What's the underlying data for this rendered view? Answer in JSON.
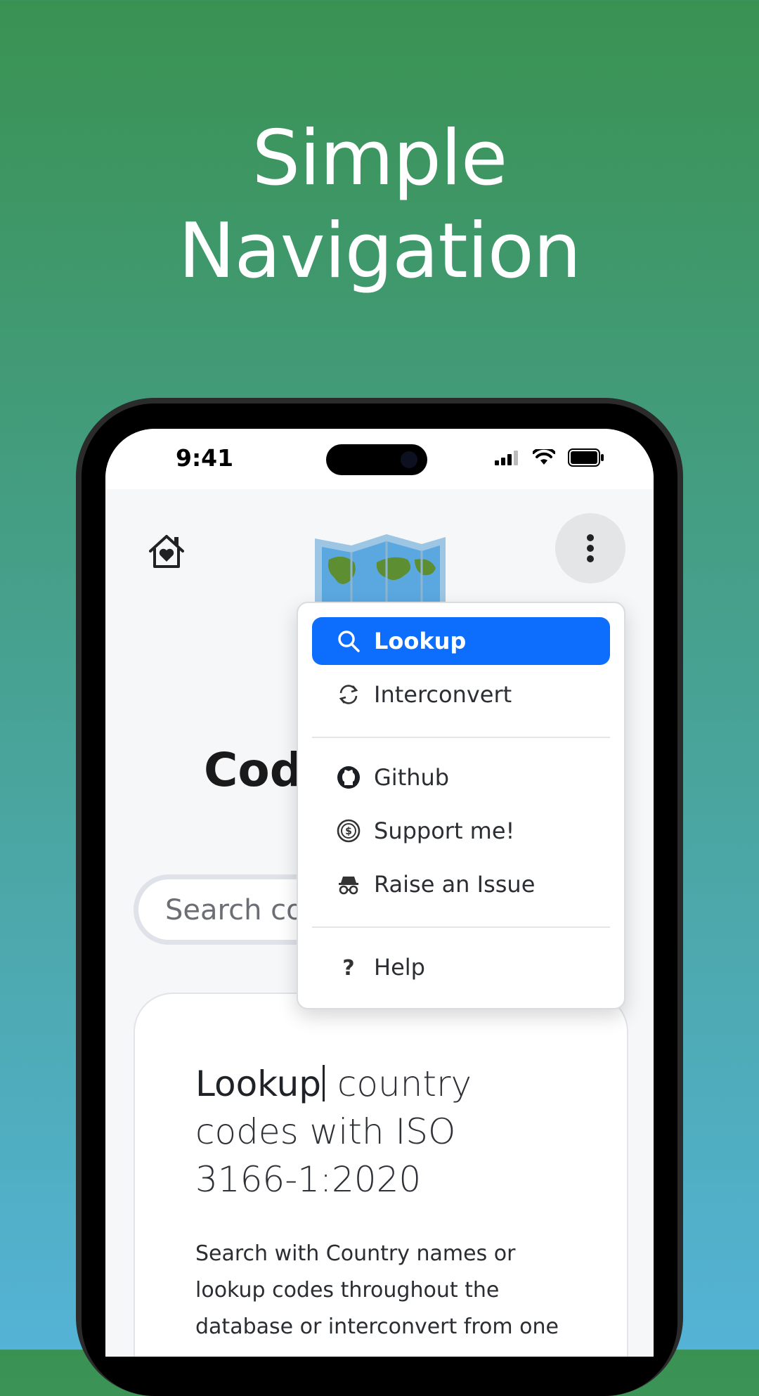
{
  "headline": {
    "line1": "Simple",
    "line2": "Navigation"
  },
  "status_bar": {
    "time": "9:41"
  },
  "app": {
    "title_line1": "C",
    "title_line2": "Cod",
    "search_placeholder": "Search cou"
  },
  "menu": {
    "items": [
      {
        "label": "Lookup",
        "icon": "search-icon",
        "active": true
      },
      {
        "label": "Interconvert",
        "icon": "refresh-icon"
      },
      {
        "label": "Github",
        "icon": "github-icon"
      },
      {
        "label": "Support me!",
        "icon": "coin-icon"
      },
      {
        "label": "Raise an Issue",
        "icon": "spy-icon"
      },
      {
        "label": "Help",
        "icon": "question-icon"
      }
    ]
  },
  "card": {
    "title_bold": "Lookup",
    "title_rest": " country codes with ISO 3166-1:2020",
    "description": "Search with Country names or lookup codes throughout the database or interconvert from one"
  },
  "colors": {
    "accent": "#0d6efd",
    "bg_top": "#3a9252",
    "bg_bottom": "#54b3d6"
  }
}
